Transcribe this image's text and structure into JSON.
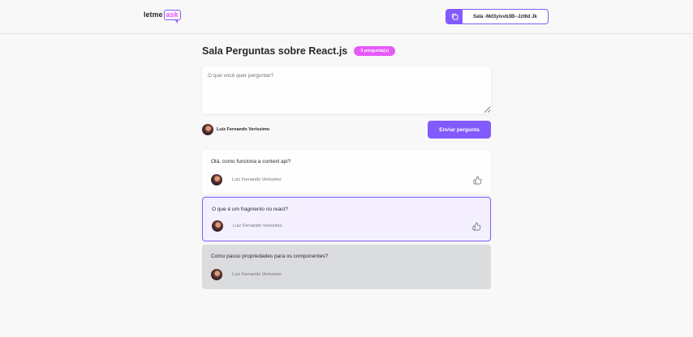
{
  "header": {
    "logo": {
      "part1": "letme",
      "part2": "ask"
    },
    "room_code": {
      "label": "Sala -Md3yivvb3B--Jzt6d Jk"
    }
  },
  "room": {
    "title": "Sala Perguntas sobre React.js",
    "badge": "3 pergunta(s)"
  },
  "form": {
    "placeholder": "O que você quer perguntar?",
    "user_name": "Luiz Fernando Verissimo",
    "submit_label": "Enviar pergunta"
  },
  "questions": [
    {
      "content": "Olá, como funciona a context api?",
      "author": "Luiz Fernando Verissimo",
      "state": "default"
    },
    {
      "content": "O que é um fragmento no react?",
      "author": "Luiz Fernando Verissimo",
      "state": "highlighted"
    },
    {
      "content": "Como passo propriedades para os componentes?",
      "author": "Luiz Fernando Verissimo",
      "state": "answered"
    }
  ],
  "colors": {
    "accent": "#835afd",
    "badge": "#e559f9",
    "background": "#f8f8f8",
    "highlight_bg": "#f4f0ff",
    "answered_bg": "#dbdcdd"
  },
  "icons": {
    "copy": "copy-icon",
    "like": "thumbs-up-icon"
  }
}
